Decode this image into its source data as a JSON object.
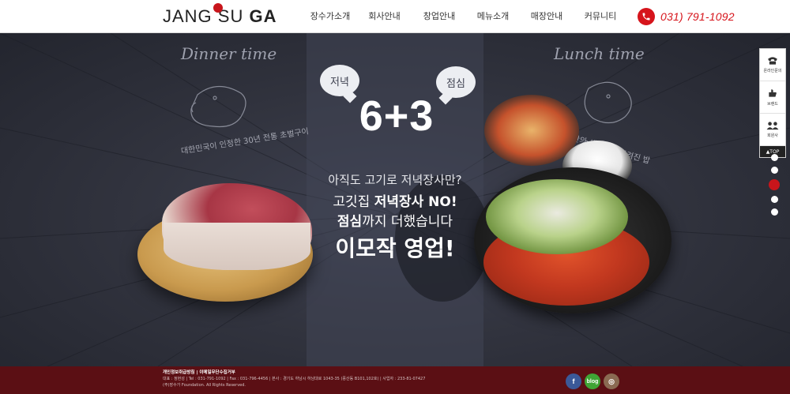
{
  "header": {
    "logo": "JANG SU GA",
    "nav": [
      "장수가소개",
      "회사안내",
      "창업안내",
      "메뉴소개",
      "매장안내",
      "커뮤니티"
    ],
    "phone": "031) 791-1092"
  },
  "hero": {
    "left_title": "Dinner time",
    "right_title": "Lunch time",
    "left_curve": "대한민국이 인정한 30년 전통 초벌구이",
    "right_curve_1": "자신만의 생존배",
    "right_curve_2": "3시간만에 차려진 밥",
    "bubble_left": "저녁",
    "bubble_right": "점심",
    "headline": "6+3",
    "line1": "아직도 고기로 저녁장사만?",
    "line2_a": "고깃집 ",
    "line2_b": "저녁장사 NO!",
    "line3_a": "점심",
    "line3_b": "까지 더했습니다",
    "line4": "이모작 영업!"
  },
  "quick_menu": {
    "items": [
      {
        "label": "온라인문의",
        "icon": "phone-icon"
      },
      {
        "label": "브랜드",
        "icon": "hand-icon"
      },
      {
        "label": "회원사",
        "icon": "people-icon"
      }
    ],
    "top": "▲TOP"
  },
  "pager": {
    "count": 5,
    "active_index": 2
  },
  "footer": {
    "links": "개인정보취급방침 | 이메일무단수집거부",
    "line1": "대표 : 정현성 | Tel : 031-791-1092 | Fax : 031-796-4456 | 본사 : 경기도 하남시 하남대로 1043-35 (풍산동 B101,102호) | 사업자 : 233-81-07427",
    "line2": "(주)장수가 Foundation. All Rights Reserved."
  },
  "social": [
    {
      "label": "f",
      "icon": "facebook-icon",
      "color": "#3b5998"
    },
    {
      "label": "blog",
      "icon": "blog-icon",
      "color": "#3fa535"
    },
    {
      "label": "◎",
      "icon": "instagram-icon",
      "color": "#8a6a52"
    }
  ],
  "colors": {
    "accent": "#d6141b",
    "footer": "#5b0f14",
    "hero_bg": "#2f3140"
  }
}
